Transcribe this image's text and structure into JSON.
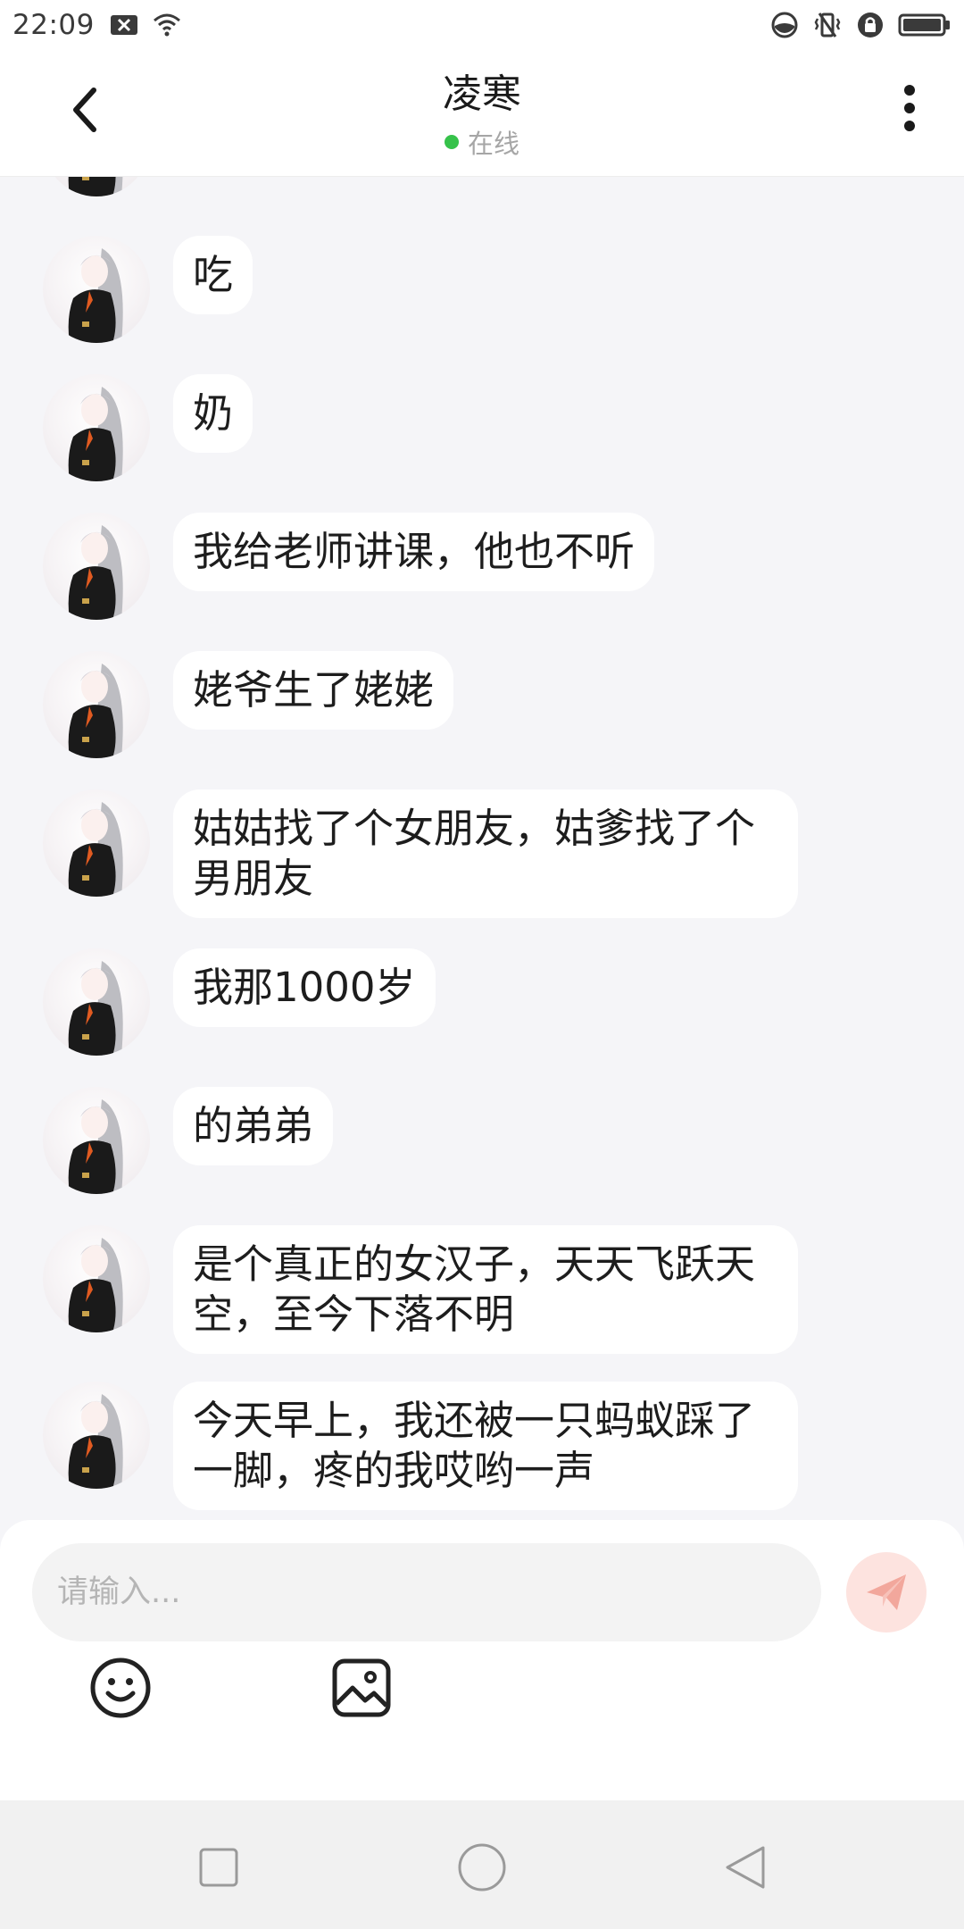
{
  "status_bar": {
    "time": "22:09"
  },
  "header": {
    "contact_name": "凌寒",
    "presence": "在线"
  },
  "messages": [
    {
      "text": "吃"
    },
    {
      "text": "奶"
    },
    {
      "text": "我给老师讲课，他也不听"
    },
    {
      "text": "姥爷生了姥姥"
    },
    {
      "text": "姑姑找了个女朋友，姑爹找了个男朋友"
    },
    {
      "text": "我那1000岁"
    },
    {
      "text": "的弟弟"
    },
    {
      "text": "是个真正的女汉子，天天飞跃天空，至今下落不明"
    },
    {
      "text": "今天早上，我还被一只蚂蚁踩了一脚，疼的我哎哟一声"
    }
  ],
  "composer": {
    "placeholder": "请输入...",
    "value": ""
  },
  "colors": {
    "background": "#f5f5f8",
    "online": "#36c24a",
    "send_button": "#fde3df",
    "send_icon": "#f2a79c"
  }
}
